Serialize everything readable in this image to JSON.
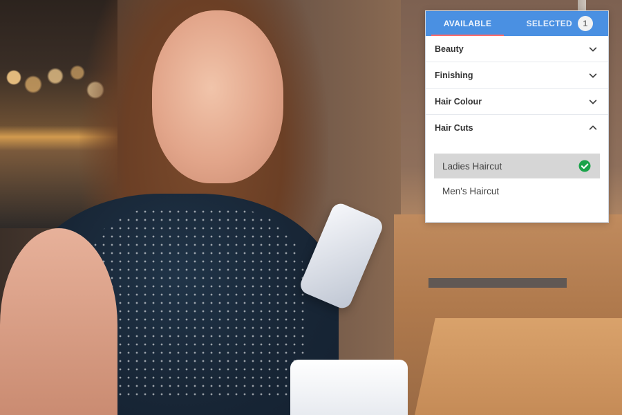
{
  "colors": {
    "tab_bar": "#4a90e2",
    "active_tab_underline": "#ff6b6b",
    "selected_item_bg": "#d6d6d6",
    "check_green": "#1aa34a"
  },
  "services_panel": {
    "tabs": [
      {
        "label": "AVAILABLE",
        "active": true
      },
      {
        "label": "SELECTED",
        "active": false,
        "badge": "1"
      }
    ],
    "categories": [
      {
        "label": "Beauty",
        "expanded": false,
        "icon": "chevron-down-icon"
      },
      {
        "label": "Finishing",
        "expanded": false,
        "icon": "chevron-down-icon"
      },
      {
        "label": "Hair Colour",
        "expanded": false,
        "icon": "chevron-down-icon"
      },
      {
        "label": "Hair Cuts",
        "expanded": true,
        "icon": "chevron-up-icon"
      }
    ],
    "hair_cuts_items": [
      {
        "label": "Ladies Haircut",
        "selected": true,
        "icon": "check-circle-icon"
      },
      {
        "label": "Men's Haircut",
        "selected": false
      }
    ]
  }
}
